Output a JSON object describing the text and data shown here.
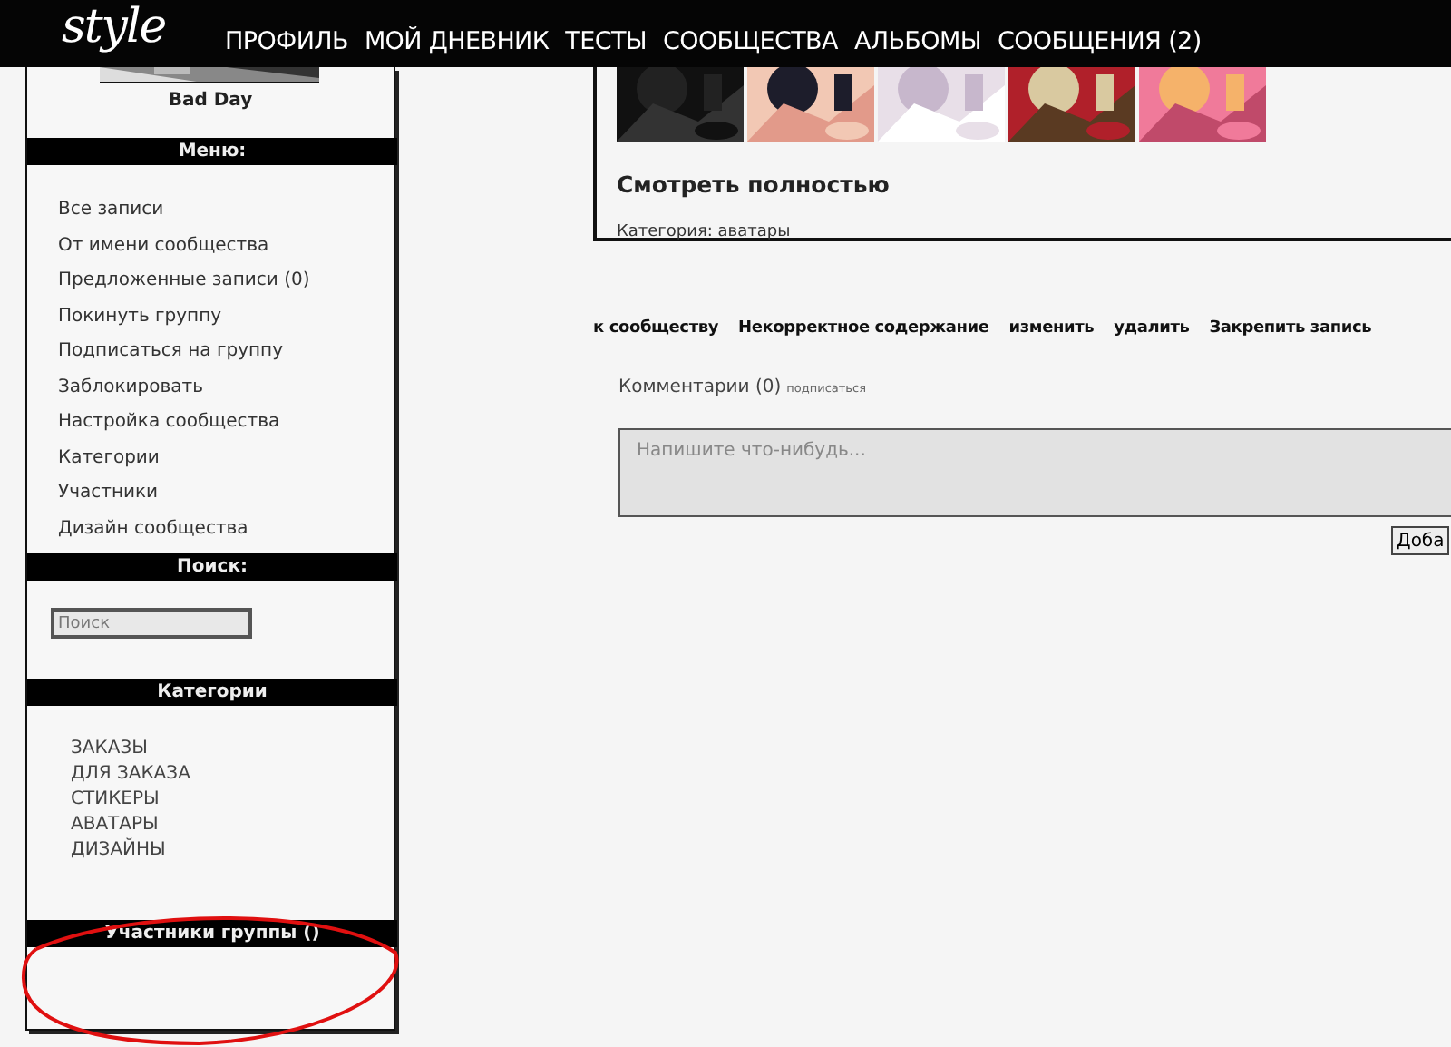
{
  "logo": "style",
  "nav": [
    "ПРОФИЛЬ",
    "МОЙ ДНЕВНИК",
    "ТЕСТЫ",
    "СООБЩЕСТВА",
    "АЛЬБОМЫ",
    "СООБЩЕНИЯ (2)"
  ],
  "sidebar": {
    "name": "Bad Day",
    "menu": {
      "title": "Меню:",
      "items": [
        "Все записи",
        "От имени сообщества",
        "Предложенные записи (0)",
        "Покинуть группу",
        "Подписаться на группу",
        "Заблокировать",
        "Настройка сообщества",
        "Категории",
        "Участники",
        "Дизайн сообщества"
      ]
    },
    "search": {
      "title": "Поиск:",
      "placeholder": "Поиск"
    },
    "categories": {
      "title": "Категории",
      "items": [
        "ЗАКАЗЫ",
        "ДЛЯ ЗАКАЗА",
        "СТИКЕРЫ",
        "АВАТАРЫ",
        "ДИЗАЙНЫ"
      ]
    },
    "members": {
      "title": "Участники группы ()"
    }
  },
  "post": {
    "more_link": "Смотреть полностью",
    "category": "Категория: аватары"
  },
  "actions": [
    "к сообществу",
    "Некорректное содержание",
    "изменить",
    "удалить",
    "Закрепить запись"
  ],
  "comments": {
    "label": "Комментарии (0)",
    "subscribe": "подписаться",
    "placeholder": "Напишите что-нибудь...",
    "submit": "Доба"
  }
}
